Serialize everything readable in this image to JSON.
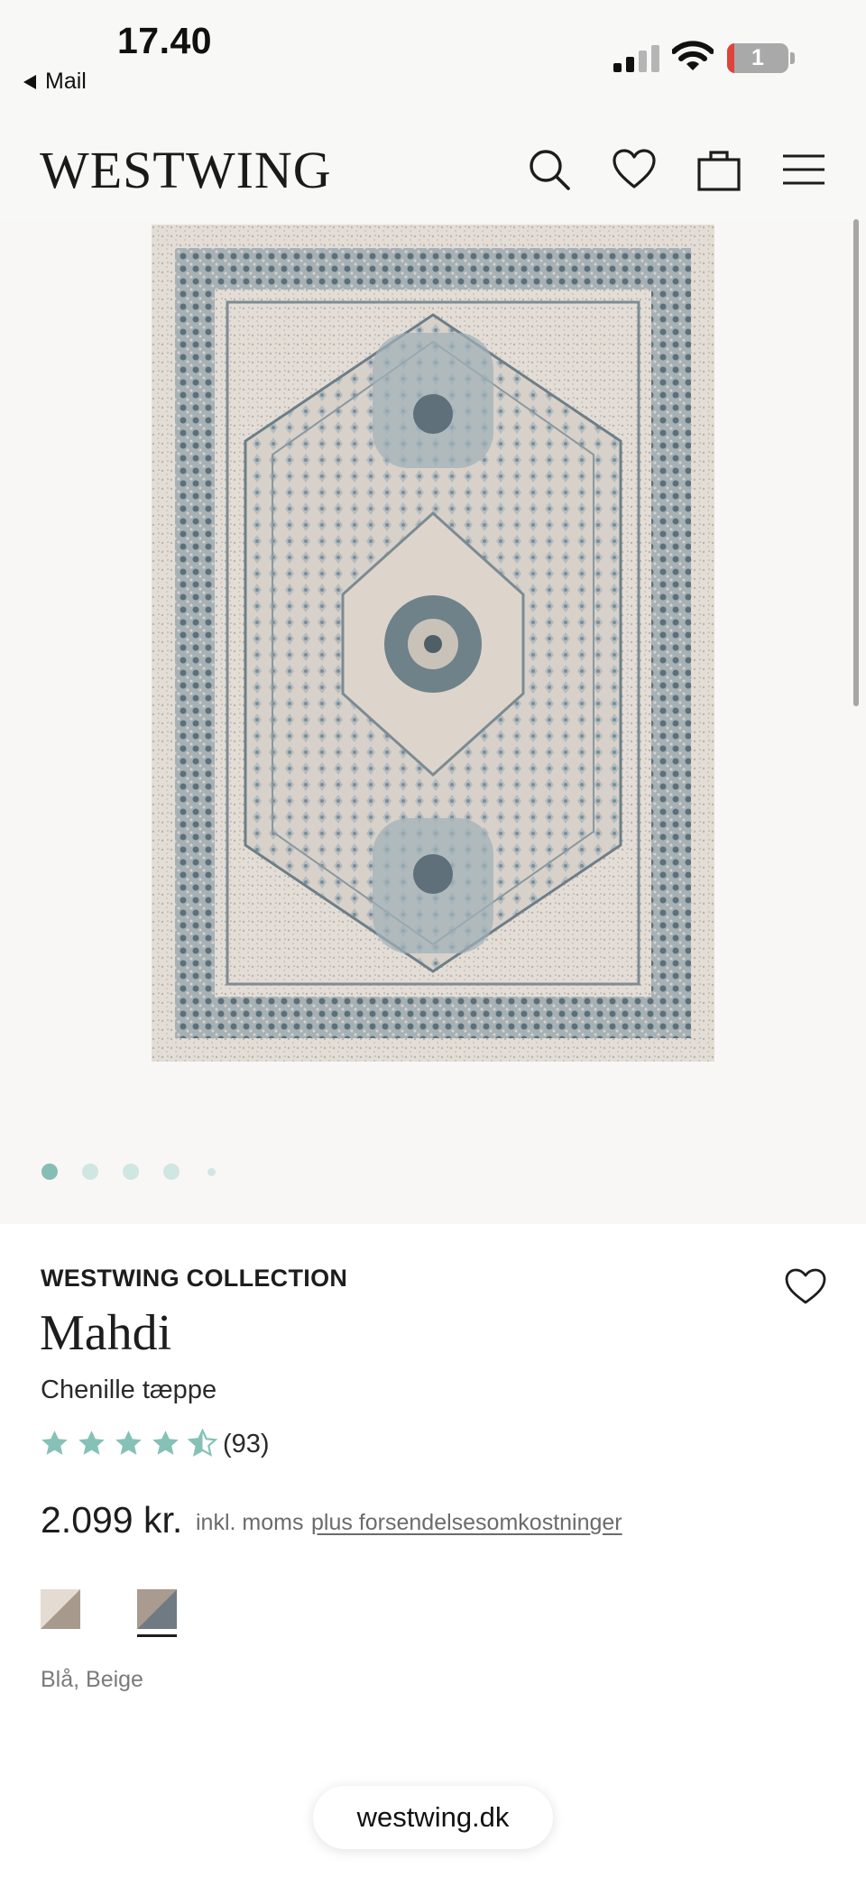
{
  "status_bar": {
    "time": "17.40",
    "back_label": "Mail",
    "battery_level": "1"
  },
  "header": {
    "logo": "WESTWING",
    "icons": [
      "search-icon",
      "heart-icon",
      "shopping-bag-icon",
      "menu-icon"
    ]
  },
  "gallery": {
    "slide_count": 5,
    "active_slide": 1,
    "colors": {
      "dot_active": "#86bdb4",
      "dot_inactive": "#cfe6e2"
    }
  },
  "product": {
    "brand": "WESTWING COLLECTION",
    "name": "Mahdi",
    "subtitle": "Chenille tæppe",
    "rating": 4.5,
    "rating_max": 5,
    "review_count": "(93)",
    "price": "2.099 kr.",
    "tax_note": "inkl. moms",
    "shipping_link": "plus forsendelsesomkostninger",
    "color_label": "Blå, Beige",
    "swatches": [
      {
        "name": "beige",
        "colors": [
          "#e4dcd2",
          "#a79a8d"
        ],
        "selected": false
      },
      {
        "name": "blue-beige",
        "colors": [
          "#a99b8f",
          "#6f7a83"
        ],
        "selected": true
      }
    ],
    "star_color": "#86c1b7"
  },
  "browser": {
    "url": "westwing.dk"
  }
}
